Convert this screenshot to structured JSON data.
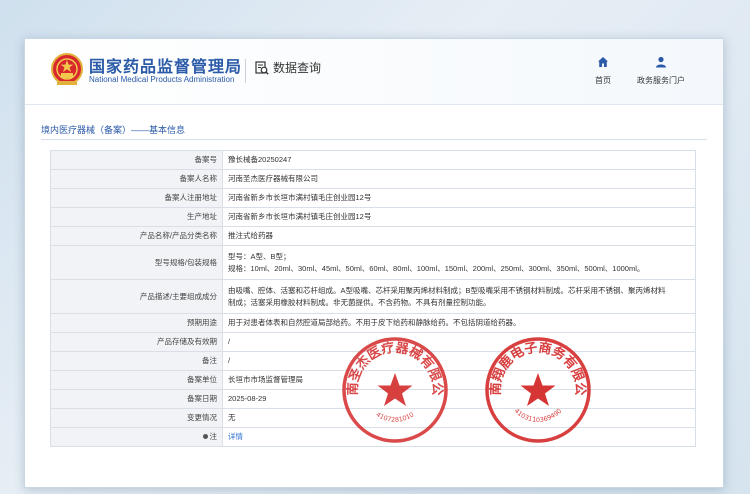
{
  "header": {
    "brand_cn": "国家药品监督管理局",
    "brand_en": "National Medical Products Administration",
    "query_label": "数据查询",
    "nav": [
      {
        "label": "首页",
        "icon": "home-icon"
      },
      {
        "label": "政务服务门户",
        "icon": "user-icon"
      }
    ]
  },
  "section_title": "境内医疗器械（备案）——基本信息",
  "rows": [
    {
      "key": "备案号",
      "value": "豫长械备20250247"
    },
    {
      "key": "备案人名称",
      "value": "河南圣杰医疗器械有限公司"
    },
    {
      "key": "备案人注册地址",
      "value": "河南省新乡市长垣市满村镇毛庄创业园12号"
    },
    {
      "key": "生产地址",
      "value": "河南省新乡市长垣市满村镇毛庄创业园12号"
    },
    {
      "key": "产品名称/产品分类名称",
      "value": "推注式给药器"
    },
    {
      "key": "型号规格/包装规格",
      "value": "型号：A型、B型；",
      "value2": "规格：10ml、20ml、30ml、45ml、50ml、60ml、80ml、100ml、150ml、200ml、250ml、300ml、350ml、500ml、1000ml。"
    },
    {
      "key": "产品描述/主要组成成分",
      "value": "由吸嘴、腔体、活塞和芯杆组成。A型吸嘴、芯杆采用聚丙烯材料制成；B型吸嘴采用不锈钢材料制成。芯杆采用不锈钢、聚丙烯材料",
      "value2": "制成；活塞采用橡胶材料制成。非无菌提供。不含药物。不具有剂量控制功能。"
    },
    {
      "key": "预期用途",
      "value": "用于对患者体表和自然腔道局部给药。不用于皮下给药和静脉给药。不包括阴道给药器。"
    },
    {
      "key": "产品存储及有效期",
      "value": "/"
    },
    {
      "key": "备注",
      "value": "/"
    },
    {
      "key": "备案单位",
      "value": "长垣市市场监督管理局"
    },
    {
      "key": "备案日期",
      "value": "2025-08-29"
    },
    {
      "key": "变更情况",
      "value": "无"
    },
    {
      "key": "注",
      "value": "详情"
    }
  ],
  "stamps": [
    {
      "top_text": "河南圣杰医疗器械有限公司",
      "bottom_text": "4107281010",
      "color": "#d42a2a"
    },
    {
      "top_text": "河南翔鹿电子商务有限公司",
      "bottom_text": "4103110369490",
      "color": "#d42a2a"
    }
  ],
  "colors": {
    "brand": "#2b5aa8",
    "link": "#2b6fd1",
    "stamp": "#d42a2a"
  }
}
